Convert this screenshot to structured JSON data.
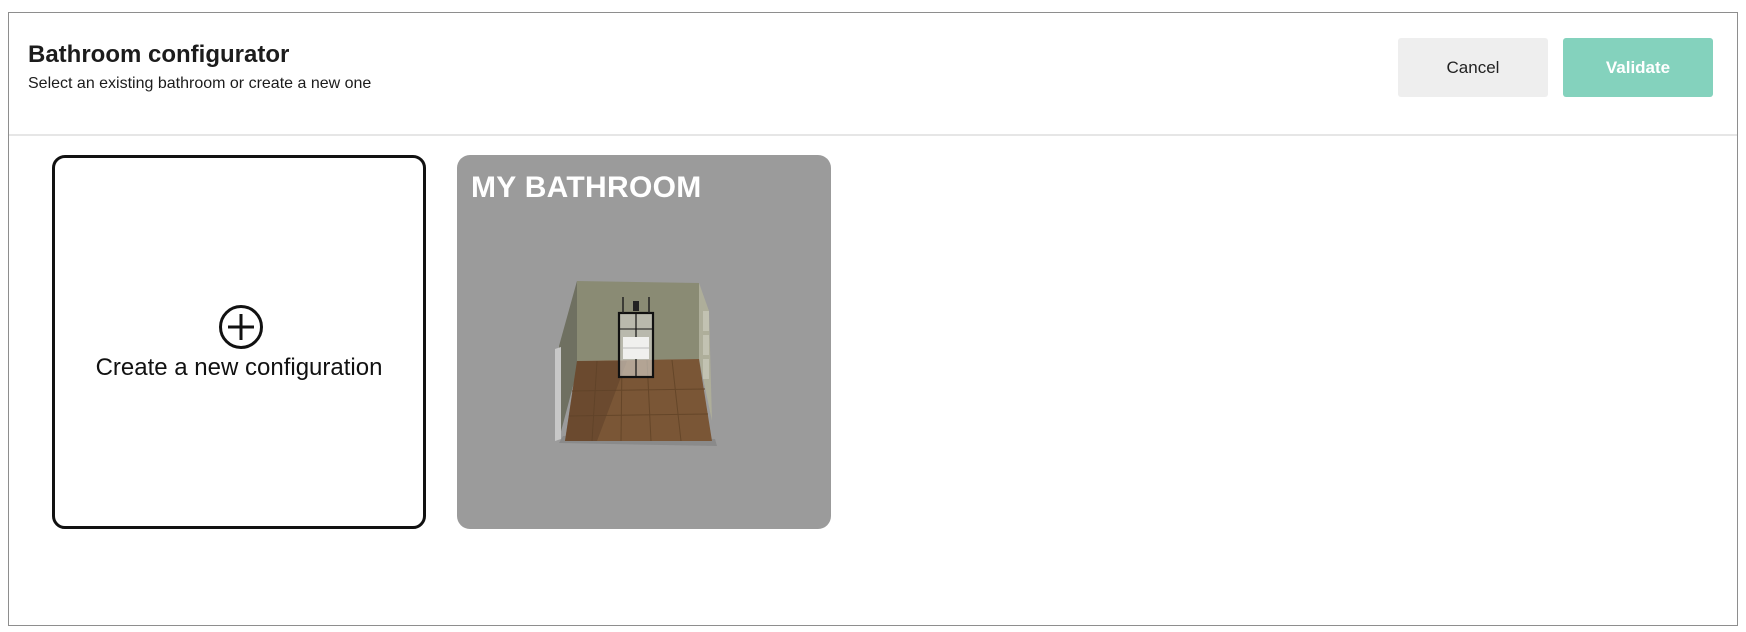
{
  "header": {
    "title": "Bathroom configurator",
    "subtitle": "Select an existing bathroom or create a new one"
  },
  "actions": {
    "cancel_label": "Cancel",
    "validate_label": "Validate"
  },
  "cards": {
    "new_label": "Create a new configuration",
    "new_icon": "plus-circle-icon",
    "existing": [
      {
        "name": "MY BATHROOM"
      }
    ]
  },
  "colors": {
    "validate_button": "#84d2bd",
    "cancel_button": "#eeeeee",
    "existing_card": "#9b9b9b"
  }
}
